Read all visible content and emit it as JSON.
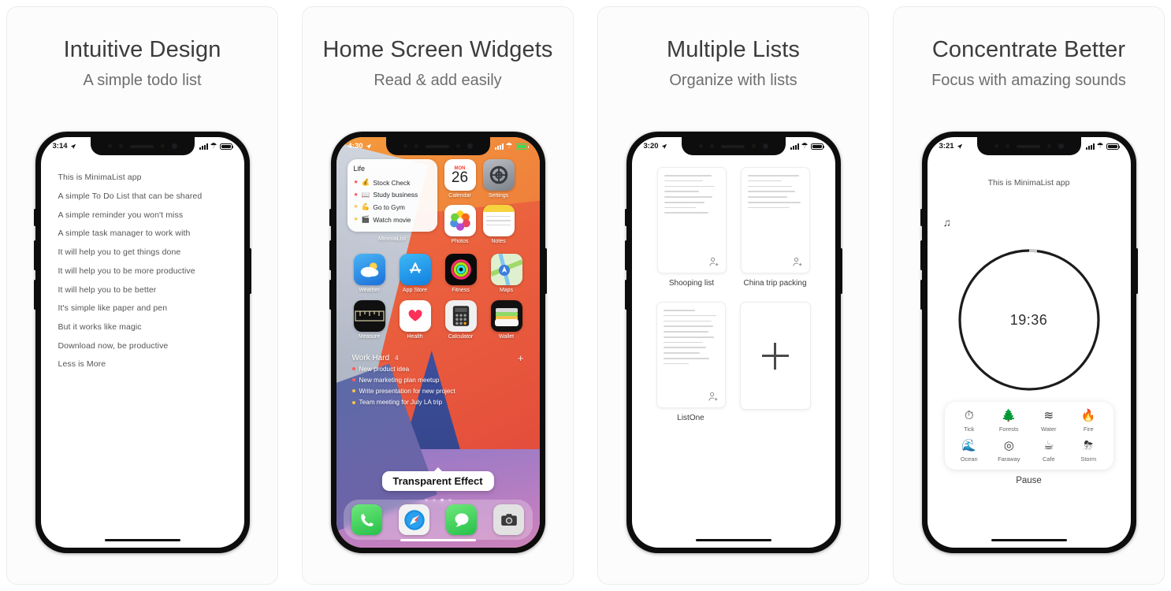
{
  "panels": [
    {
      "title": "Intuitive Design",
      "subtitle": "A simple todo list",
      "status": {
        "time": "3:14",
        "battery_color": "#111111"
      },
      "todo_items": [
        "This is MinimaList app",
        "A simple To Do List that can be shared",
        "A simple reminder you won't miss",
        "A simple task manager to work with",
        "It will help you to get things done",
        "It will help you to be more productive",
        "It will help you to be better",
        "It's simple like paper and pen",
        "But it works like magic",
        "Download now, be productive",
        "Less is More"
      ]
    },
    {
      "title": "Home Screen Widgets",
      "subtitle": "Read & add easily",
      "status": {
        "time": "4:30",
        "battery_color": "#3ddc5b"
      },
      "widget": {
        "name": "Life",
        "app_label": "MinimaList",
        "items": [
          {
            "emoji": "💰",
            "text": "Stock Check",
            "dot": "red"
          },
          {
            "emoji": "📖",
            "text": "Study business",
            "dot": "red"
          },
          {
            "emoji": "💪",
            "text": "Go to Gym",
            "dot": "yellow"
          },
          {
            "emoji": "🎬",
            "text": "Watch movie",
            "dot": "yellow"
          }
        ]
      },
      "calendar": {
        "weekday": "MON",
        "day": "26",
        "label": "Calendar"
      },
      "apps_row_top": [
        "Settings",
        "Notes"
      ],
      "apps": [
        {
          "label": "Weather",
          "icon": "weather-icon"
        },
        {
          "label": "App Store",
          "icon": "appstore-icon"
        },
        {
          "label": "Fitness",
          "icon": "fitness-icon"
        },
        {
          "label": "Maps",
          "icon": "maps-icon"
        },
        {
          "label": "Measure",
          "icon": "measure-icon"
        },
        {
          "label": "Health",
          "icon": "health-icon"
        },
        {
          "label": "Calculator",
          "icon": "calculator-icon"
        },
        {
          "label": "Wallet",
          "icon": "wallet-icon"
        }
      ],
      "photos_label": "Photos",
      "big_widget": {
        "name": "Work Hard",
        "count": "4",
        "add": "+",
        "items": [
          {
            "text": "New product idea",
            "dot": "red"
          },
          {
            "text": "New marketing plan meetup",
            "dot": "red"
          },
          {
            "text": "Write presentation for new project",
            "dot": "yellow"
          },
          {
            "text": "Team meeting for July LA trip",
            "dot": "yellow"
          }
        ]
      },
      "tooltip": "Transparent Effect",
      "page_dots": 4,
      "page_active": 3,
      "dock": [
        {
          "label": "Phone",
          "icon": "phone-icon"
        },
        {
          "label": "Safari",
          "icon": "safari-icon"
        },
        {
          "label": "Messages",
          "icon": "messages-icon"
        },
        {
          "label": "Camera",
          "icon": "camera-icon"
        }
      ]
    },
    {
      "title": "Multiple Lists",
      "subtitle": "Organize with lists",
      "status": {
        "time": "3:20",
        "battery_color": "#111111"
      },
      "lists": [
        {
          "name": "Shooping list",
          "lines": 8,
          "shared": true
        },
        {
          "name": "China trip packing",
          "lines": 7,
          "shared": true
        },
        {
          "name": "ListOne",
          "lines": 11,
          "shared": true
        }
      ],
      "add_card": "+"
    },
    {
      "title": "Concentrate Better",
      "subtitle": "Focus with amazing sounds",
      "status": {
        "time": "3:21",
        "battery_color": "#111111"
      },
      "task": "This is MinimaList app",
      "timer": "19:36",
      "pause_label": "Pause",
      "sounds": [
        {
          "name": "Tick",
          "glyph": "⏱",
          "icon": "stopwatch-icon"
        },
        {
          "name": "Forests",
          "glyph": "🌲",
          "icon": "tree-icon"
        },
        {
          "name": "Water",
          "glyph": "≋",
          "icon": "waves-icon"
        },
        {
          "name": "Fire",
          "glyph": "🔥",
          "icon": "flame-icon"
        },
        {
          "name": "Ocean",
          "glyph": "🌊",
          "icon": "ocean-icon"
        },
        {
          "name": "Faraway",
          "glyph": "◎",
          "icon": "ripple-icon"
        },
        {
          "name": "Cafe",
          "glyph": "☕",
          "icon": "coffee-icon"
        },
        {
          "name": "Storm",
          "glyph": "⛈",
          "icon": "storm-icon"
        }
      ]
    }
  ]
}
